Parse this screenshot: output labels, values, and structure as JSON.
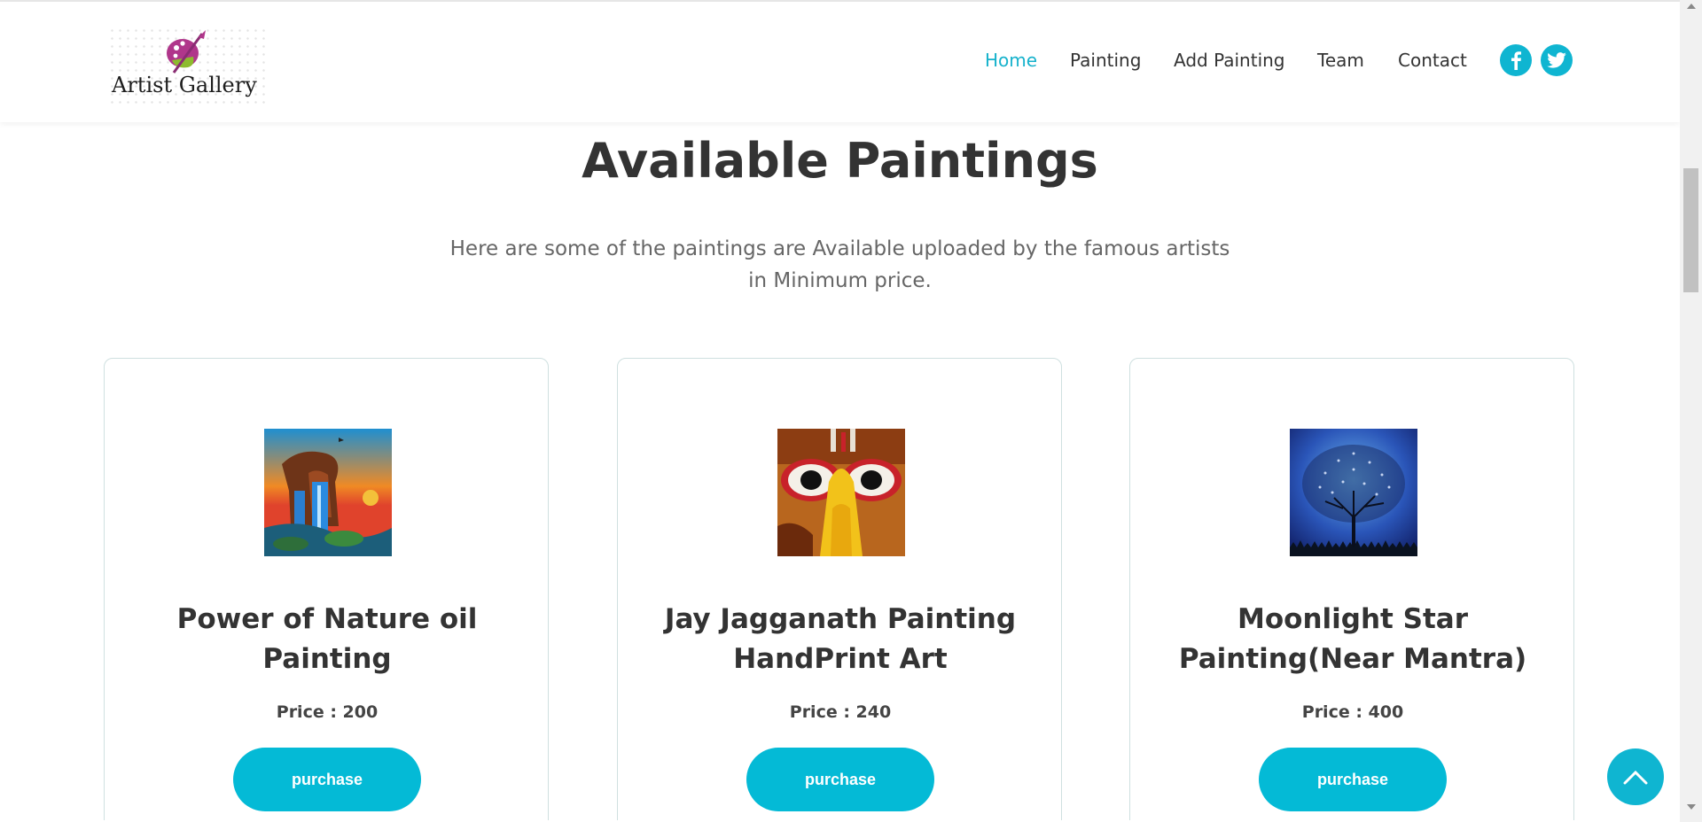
{
  "brand": {
    "name": "Artist Gallery"
  },
  "nav": {
    "items": [
      {
        "label": "Home",
        "active": true
      },
      {
        "label": "Painting",
        "active": false
      },
      {
        "label": "Add Painting",
        "active": false
      },
      {
        "label": "Team",
        "active": false
      },
      {
        "label": "Contact",
        "active": false
      }
    ],
    "social": [
      "facebook-icon",
      "twitter-icon"
    ]
  },
  "section": {
    "title": "Available Paintings",
    "subtitle": "Here are some of the paintings are Available uploaded by the famous artists in Minimum price."
  },
  "paintings": [
    {
      "title": "Power of Nature oil Painting",
      "price": "Price : 200",
      "button": "purchase",
      "image": "waterfall-painting"
    },
    {
      "title": "Jay Jagganath Painting HandPrint Art",
      "price": "Price : 240",
      "button": "purchase",
      "image": "jagannath-painting"
    },
    {
      "title": "Moonlight Star Painting(Near Mantra)",
      "price": "Price : 400",
      "button": "purchase",
      "image": "tree-night-painting"
    }
  ],
  "colors": {
    "accent": "#04bad6",
    "nav_active": "#16b2cc",
    "text": "#333333",
    "card_border": "#cfe0e0"
  },
  "icons": {
    "scroll_top": "chevron-up-icon"
  }
}
